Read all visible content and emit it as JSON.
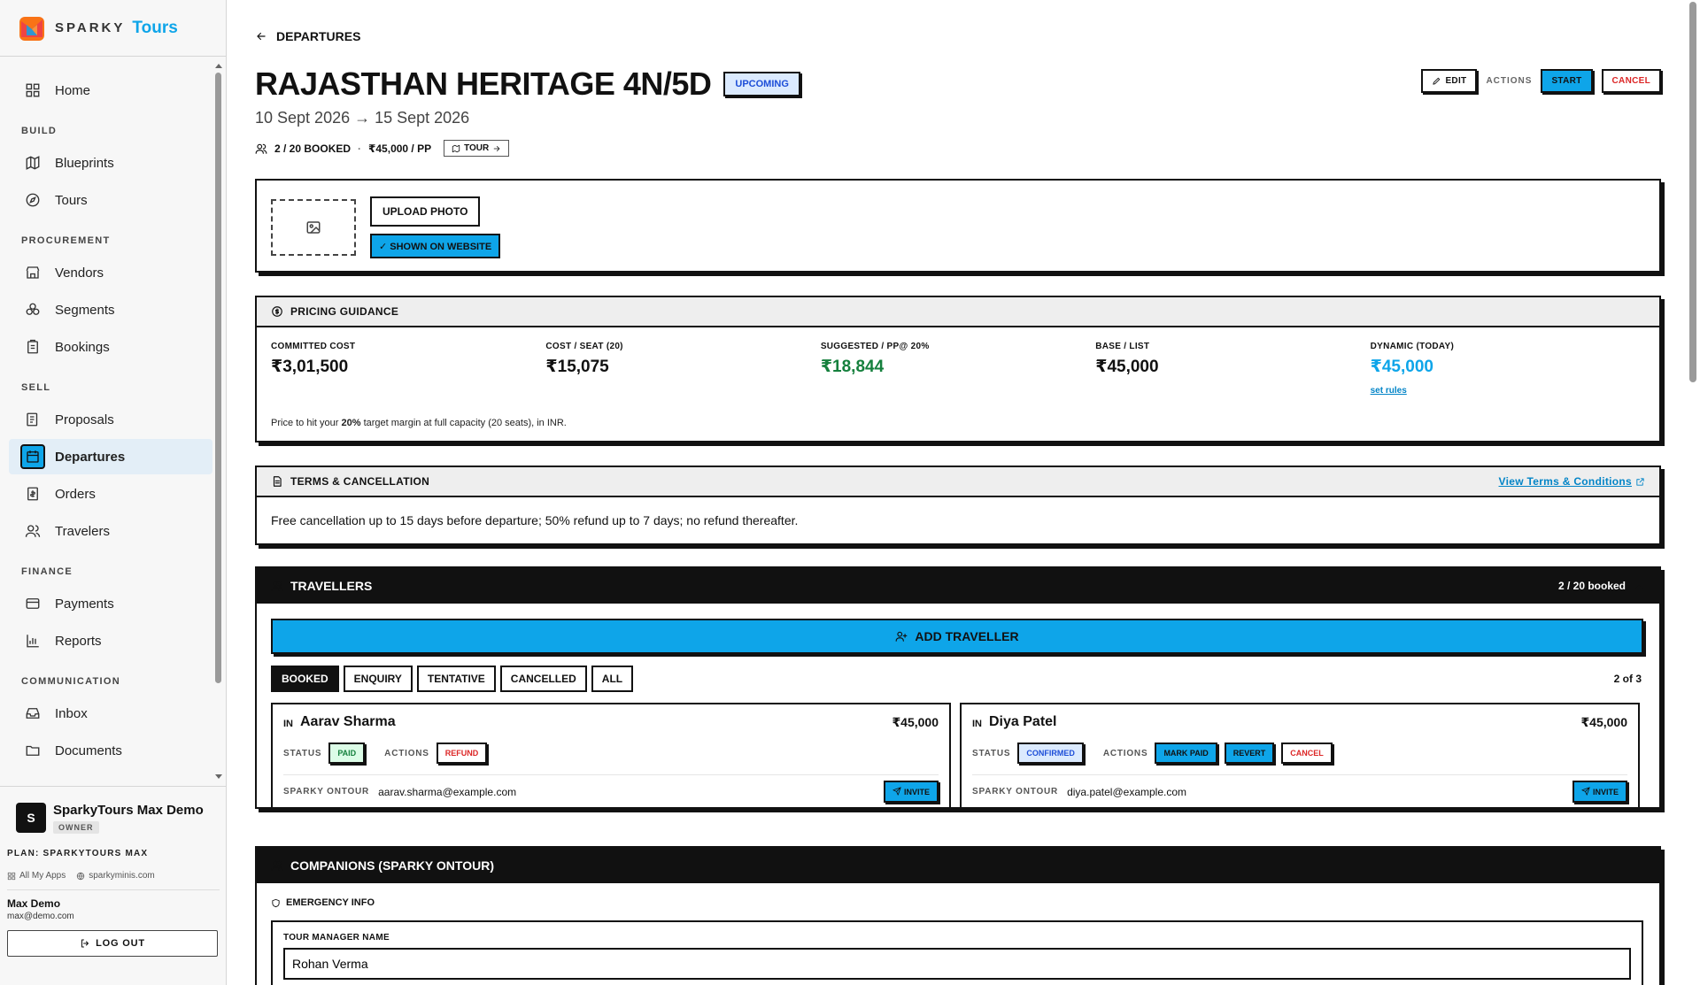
{
  "brand": {
    "name": "SPARKY",
    "accent": "Tours"
  },
  "nav": {
    "home": "Home",
    "build": "BUILD",
    "blueprints": "Blueprints",
    "tours": "Tours",
    "procurement": "PROCUREMENT",
    "vendors": "Vendors",
    "segments": "Segments",
    "bookings": "Bookings",
    "sell": "SELL",
    "proposals": "Proposals",
    "departures": "Departures",
    "orders": "Orders",
    "travelers": "Travelers",
    "finance": "FINANCE",
    "payments": "Payments",
    "reports": "Reports",
    "communication": "COMMUNICATION",
    "inbox": "Inbox",
    "documents": "Documents"
  },
  "footer": {
    "avatar": "S",
    "org_name": "SparkyTours Max Demo",
    "role": "OWNER",
    "plan": "PLAN: SPARKYTOURS MAX",
    "all_apps": "All My Apps",
    "site": "sparkyminis.com",
    "user_name": "Max Demo",
    "user_email": "max@demo.com",
    "logout": "LOG OUT"
  },
  "header": {
    "back": "DEPARTURES",
    "title": "RAJASTHAN HERITAGE 4N/5D",
    "status": "UPCOMING",
    "dates": "10 Sept 2026 → 15 Sept 2026",
    "booked": "2 / 20 BOOKED",
    "price": "₹45,000 / PP",
    "tour_link": "TOUR",
    "edit": "EDIT",
    "actions_label": "ACTIONS",
    "start": "START",
    "cancel": "CANCEL"
  },
  "photo": {
    "upload": "UPLOAD PHOTO",
    "shown": "✓ SHOWN ON WEBSITE"
  },
  "pricing": {
    "title": "PRICING GUIDANCE",
    "cols": [
      {
        "label": "COMMITTED COST",
        "value": "₹3,01,500"
      },
      {
        "label": "COST / SEAT (20)",
        "value": "₹15,075"
      },
      {
        "label": "SUGGESTED / PP@ 20%",
        "value": "₹18,844"
      },
      {
        "label": "BASE / LIST",
        "value": "₹45,000"
      },
      {
        "label": "DYNAMIC (TODAY)",
        "value": "₹45,000"
      }
    ],
    "set_rules": "set rules",
    "note_pre": "Price to hit your ",
    "note_pct": "20%",
    "note_post": " target margin at full capacity (20 seats), in INR."
  },
  "terms": {
    "title": "TERMS & CANCELLATION",
    "link": "View Terms & Conditions",
    "text": "Free cancellation up to 15 days before departure; 50% refund up to 7 days; no refund thereafter."
  },
  "travellers": {
    "title": "TRAVELLERS",
    "booked": "2 / 20 booked",
    "add": "ADD TRAVELLER",
    "tabs": [
      "BOOKED",
      "ENQUIRY",
      "TENTATIVE",
      "CANCELLED",
      "ALL"
    ],
    "count": "2 of 3",
    "status_label": "STATUS",
    "actions_label": "ACTIONS",
    "ontour_label": "SPARKY ONTOUR",
    "invite": "INVITE",
    "list": [
      {
        "country": "IN",
        "name": "Aarav Sharma",
        "amount": "₹45,000",
        "status": "PAID",
        "actions": [
          "REFUND"
        ],
        "email": "aarav.sharma@example.com"
      },
      {
        "country": "IN",
        "name": "Diya Patel",
        "amount": "₹45,000",
        "status": "CONFIRMED",
        "actions": [
          "MARK PAID",
          "REVERT",
          "CANCEL"
        ],
        "email": "diya.patel@example.com"
      }
    ]
  },
  "companions": {
    "title": "COMPANIONS (SPARKY ONTOUR)",
    "emergency": "EMERGENCY INFO",
    "tm_label": "TOUR MANAGER NAME",
    "tm_value": "Rohan Verma"
  },
  "colors": {
    "accent": "#0ea5e9",
    "green": "#15803d",
    "red": "#dc2626",
    "blue_text": "#1d4ed8"
  }
}
